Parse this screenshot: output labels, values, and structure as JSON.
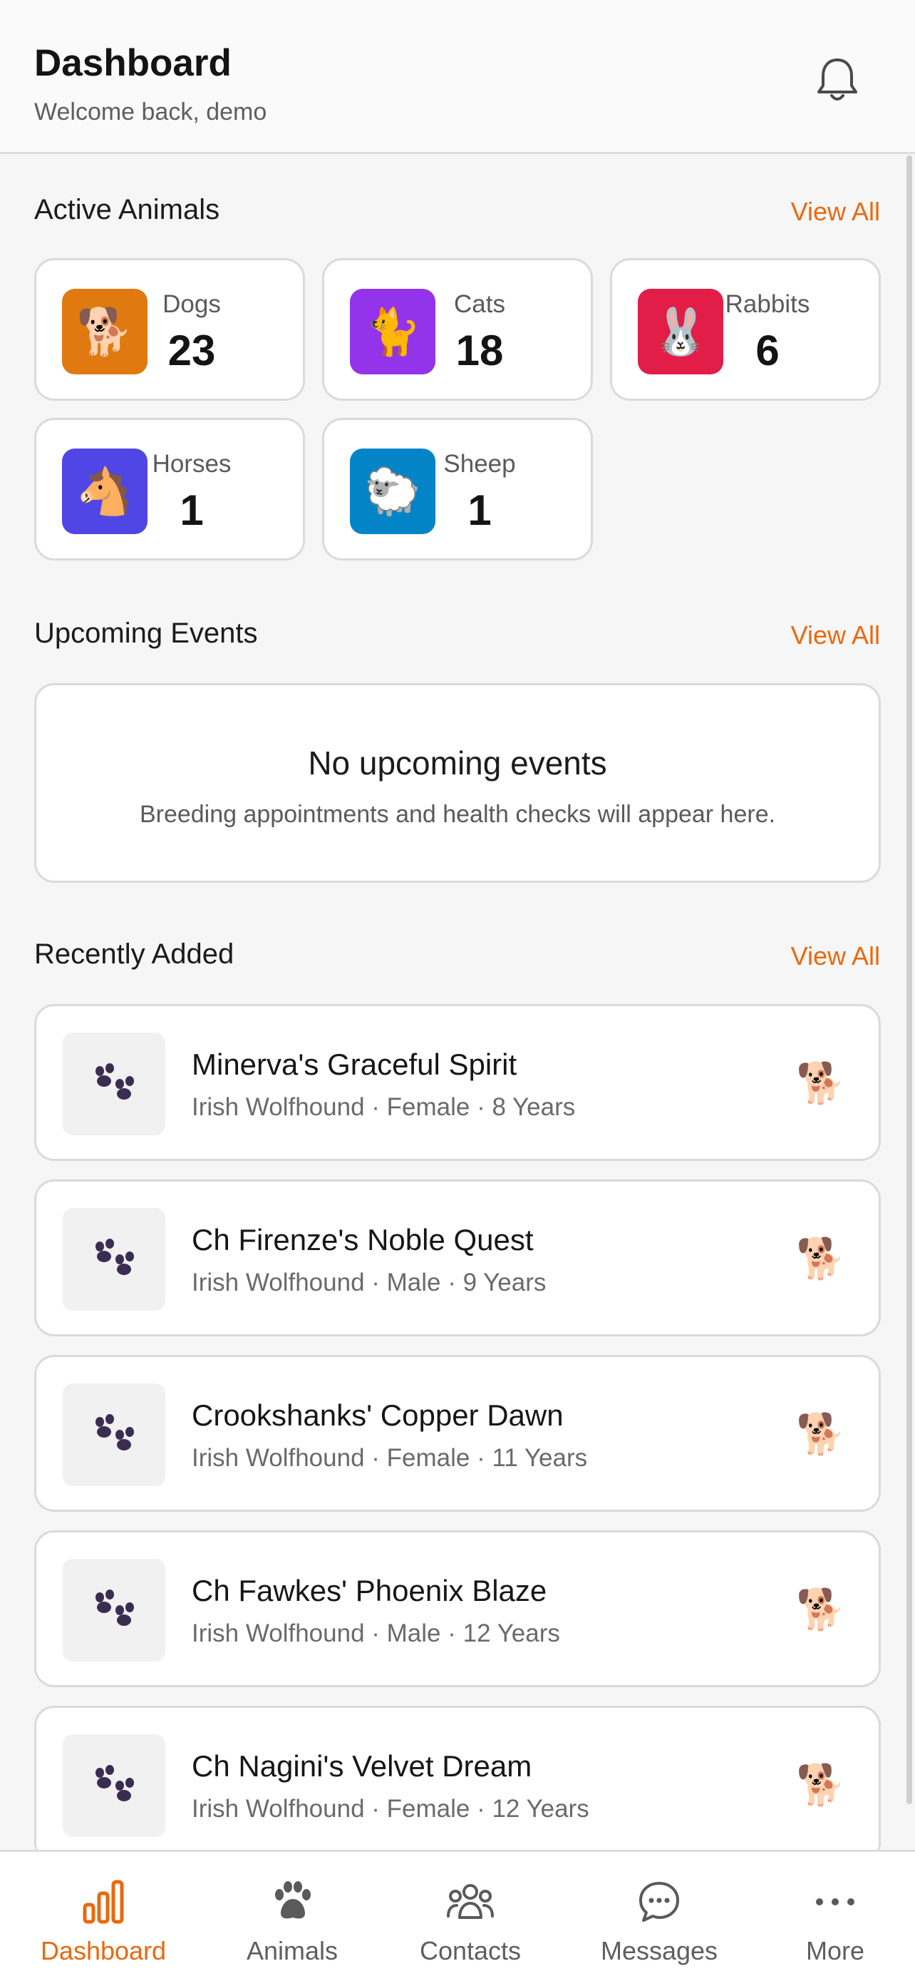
{
  "header": {
    "title": "Dashboard",
    "subtitle": "Welcome back, demo"
  },
  "colors": {
    "accent": "#e8690f",
    "dogs": "#e07a10",
    "cats": "#9333ea",
    "rabbits": "#e11d48",
    "horses": "#4f46e5",
    "sheep": "#0284c7"
  },
  "active_animals": {
    "title": "Active Animals",
    "view_all": "View All",
    "stats": [
      {
        "label": "Dogs",
        "count": "23",
        "icon": "dog-icon",
        "emoji": "🐕"
      },
      {
        "label": "Cats",
        "count": "18",
        "icon": "cat-icon",
        "emoji": "🐈"
      },
      {
        "label": "Rabbits",
        "count": "6",
        "icon": "rabbit-icon",
        "emoji": "🐰"
      },
      {
        "label": "Horses",
        "count": "1",
        "icon": "horse-icon",
        "emoji": "🐴"
      },
      {
        "label": "Sheep",
        "count": "1",
        "icon": "sheep-icon",
        "emoji": "🐑"
      }
    ]
  },
  "upcoming_events": {
    "title": "Upcoming Events",
    "view_all": "View All",
    "empty_title": "No upcoming events",
    "empty_desc": "Breeding appointments and health checks will appear here."
  },
  "recently_added": {
    "title": "Recently Added",
    "view_all": "View All",
    "items": [
      {
        "name": "Minerva's Graceful Spirit",
        "meta": "Irish Wolfhound · Female · 8 Years",
        "species_emoji": "🐕"
      },
      {
        "name": "Ch Firenze's Noble Quest",
        "meta": "Irish Wolfhound · Male · 9 Years",
        "species_emoji": "🐕"
      },
      {
        "name": "Crookshanks' Copper Dawn",
        "meta": "Irish Wolfhound · Female · 11 Years",
        "species_emoji": "🐕"
      },
      {
        "name": "Ch Fawkes' Phoenix Blaze",
        "meta": "Irish Wolfhound · Male · 12 Years",
        "species_emoji": "🐕"
      },
      {
        "name": "Ch Nagini's Velvet Dream",
        "meta": "Irish Wolfhound · Female · 12 Years",
        "species_emoji": "🐕"
      }
    ]
  },
  "bottom_nav": {
    "active": "Dashboard",
    "items": [
      {
        "label": "Dashboard",
        "icon": "bar-chart-icon"
      },
      {
        "label": "Animals",
        "icon": "paw-icon"
      },
      {
        "label": "Contacts",
        "icon": "people-icon"
      },
      {
        "label": "Messages",
        "icon": "chat-bubble-icon"
      },
      {
        "label": "More",
        "icon": "more-dots-icon"
      }
    ]
  }
}
